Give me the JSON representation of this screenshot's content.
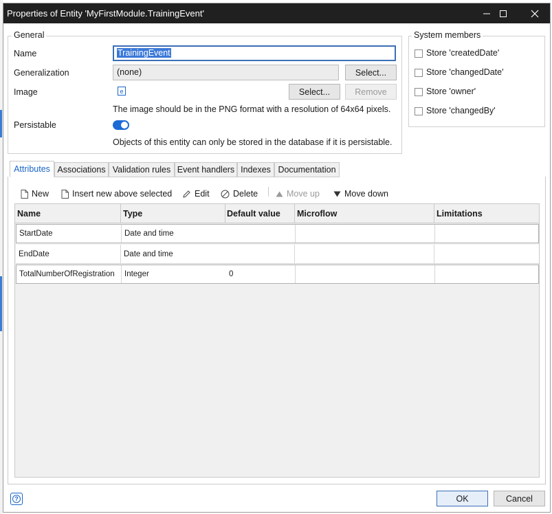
{
  "window": {
    "title": "Properties of Entity 'MyFirstModule.TrainingEvent'"
  },
  "general": {
    "legend": "General",
    "name_label": "Name",
    "name_value": "TrainingEvent",
    "generalization_label": "Generalization",
    "generalization_value": "(none)",
    "generalization_select": "Select...",
    "image_label": "Image",
    "image_select": "Select...",
    "image_remove": "Remove",
    "image_note": "The image should be in the PNG format with a resolution of 64x64 pixels.",
    "persistable_label": "Persistable",
    "persistable_on": true,
    "persistable_note": "Objects of this entity can only be stored in the database if it is persistable."
  },
  "system_members": {
    "legend": "System members",
    "items": [
      {
        "label": "Store 'createdDate'",
        "checked": false
      },
      {
        "label": "Store 'changedDate'",
        "checked": false
      },
      {
        "label": "Store 'owner'",
        "checked": false
      },
      {
        "label": "Store 'changedBy'",
        "checked": false
      }
    ]
  },
  "tabs": [
    {
      "label": "Attributes",
      "active": true
    },
    {
      "label": "Associations",
      "active": false
    },
    {
      "label": "Validation rules",
      "active": false
    },
    {
      "label": "Event handlers",
      "active": false
    },
    {
      "label": "Indexes",
      "active": false
    },
    {
      "label": "Documentation",
      "active": false
    }
  ],
  "toolbar": {
    "new": "New",
    "insert_above": "Insert new above selected",
    "edit": "Edit",
    "delete": "Delete",
    "move_up": "Move up",
    "move_down": "Move down"
  },
  "attributes_table": {
    "columns": [
      "Name",
      "Type",
      "Default value",
      "Microflow",
      "Limitations"
    ],
    "rows": [
      [
        "StartDate",
        "Date and time",
        "",
        "",
        ""
      ],
      [
        "EndDate",
        "Date and time",
        "",
        "",
        ""
      ],
      [
        "TotalNumberOfRegistration",
        "Integer",
        "0",
        "",
        ""
      ]
    ]
  },
  "footer": {
    "help": "?",
    "ok": "OK",
    "cancel": "Cancel"
  },
  "colors": {
    "accent": "#1a64c8",
    "titlebar": "#202020",
    "selection": "#3b79d8"
  }
}
